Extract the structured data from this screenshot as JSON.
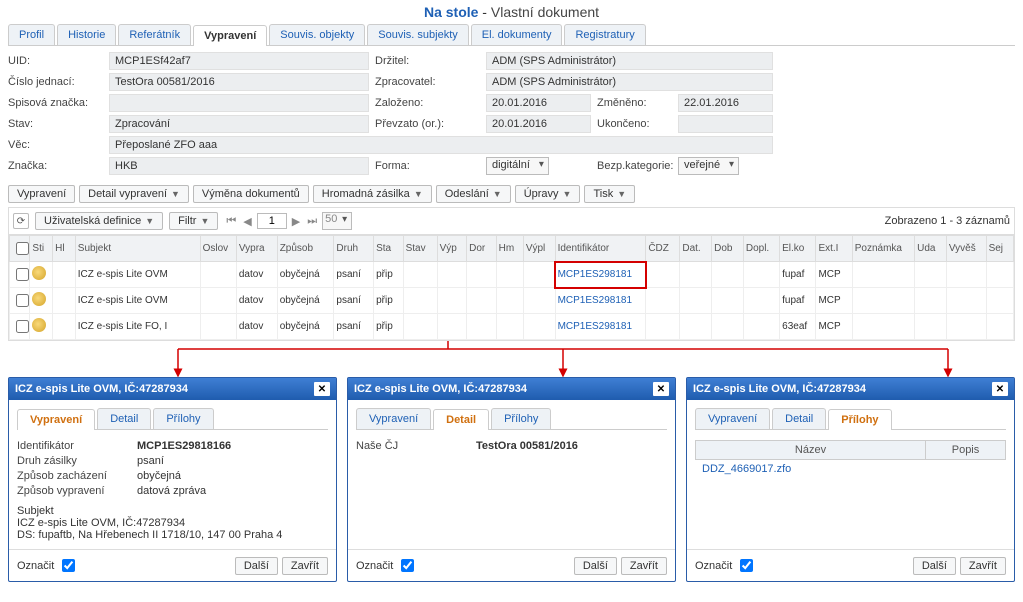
{
  "page": {
    "title1": "Na stole",
    "sep": " - ",
    "title2": "Vlastní dokument"
  },
  "mainTabs": [
    "Profil",
    "Historie",
    "Referátník",
    "Vypravení",
    "Souvis. objekty",
    "Souvis. subjekty",
    "El. dokumenty",
    "Registratury"
  ],
  "mainTabActive": "Vypravení",
  "form": {
    "labels": {
      "uid": "UID:",
      "cj": "Číslo jednací:",
      "sz": "Spisová značka:",
      "stav": "Stav:",
      "vec": "Věc:",
      "znacka": "Značka:",
      "drzitel": "Držitel:",
      "zprac": "Zpracovatel:",
      "zalozeno": "Založeno:",
      "prevzato": "Převzato (or.):",
      "zmeneno": "Změněno:",
      "ukonceno": "Ukončeno:",
      "forma": "Forma:",
      "bezp": "Bezp.kategorie:"
    },
    "values": {
      "uid": "MCP1ESf42af7",
      "cj": "TestOra 00581/2016",
      "sz": "",
      "stav": "Zpracování",
      "vec": "Přeposlané ZFO aaa",
      "znacka": "HKB",
      "drzitel": "ADM (SPS Administrátor)",
      "zprac": "ADM (SPS Administrátor)",
      "zalozeno": "20.01.2016",
      "prevzato": "20.01.2016",
      "zmeneno": "22.01.2016",
      "ukonceno": "",
      "forma": "digitální",
      "bezp": "veřejné"
    }
  },
  "toolbar": {
    "vypraveni": "Vypravení",
    "detail": "Detail vypravení",
    "vymena": "Výměna dokumentů",
    "hromadna": "Hromadná zásilka",
    "odeslani": "Odeslání",
    "upravy": "Úpravy",
    "tisk": "Tisk"
  },
  "gridbar": {
    "uzdef": "Uživatelská definice",
    "filtr": "Filtr",
    "page": "1",
    "pagesize": "50",
    "summary": "Zobrazeno 1 - 3 záznamů"
  },
  "gridCols": [
    "",
    "Sti",
    "Hl",
    "Subjekt",
    "Oslov",
    "Vypra",
    "Způsob",
    "Druh",
    "Sta",
    "Stav",
    "Výp",
    "Dor",
    "Hm",
    "Výpl",
    "Identifikátor",
    "ČDZ",
    "Dat.",
    "Dob",
    "Dopl.",
    "El.ko",
    "Ext.I",
    "Poznámka",
    "Uda",
    "Vyvěš",
    "Sej"
  ],
  "gridRows": [
    {
      "subjekt": "ICZ e-spis Lite OVM",
      "vypra": "datov",
      "zpusob": "obyčejná",
      "druh": "psaní",
      "sta": "přip",
      "ident": "MCP1ES298181",
      "elko": "fupaf",
      "exti": "MCP"
    },
    {
      "subjekt": "ICZ e-spis Lite OVM",
      "vypra": "datov",
      "zpusob": "obyčejná",
      "druh": "psaní",
      "sta": "přip",
      "ident": "MCP1ES298181",
      "elko": "fupaf",
      "exti": "MCP"
    },
    {
      "subjekt": "ICZ e-spis Lite FO, I",
      "vypra": "datov",
      "zpusob": "obyčejná",
      "druh": "psaní",
      "sta": "přip",
      "ident": "MCP1ES298181",
      "elko": "63eaf",
      "exti": "MCP"
    }
  ],
  "panelTitle": "ICZ e-spis Lite OVM, IČ:47287934",
  "innerTabs": {
    "vypraveni": "Vypravení",
    "detail": "Detail",
    "prilohy": "Přílohy"
  },
  "panel1": {
    "kv": {
      "ident_k": "Identifikátor",
      "ident_v": "MCP1ES29818166",
      "druh_k": "Druh zásilky",
      "druh_v": "psaní",
      "zach_k": "Způsob zacházení",
      "zach_v": "obyčejná",
      "vypr_k": "Způsob vypravení",
      "vypr_v": "datová zpráva"
    },
    "subj_h": "Subjekt",
    "subj_l1": "ICZ e-spis Lite OVM, IČ:47287934",
    "subj_l2": "DS: fupaftb, Na Hřebenech II 1718/10, 147 00 Praha 4"
  },
  "panel2": {
    "nase_k": "Naše ČJ",
    "nase_v": "TestOra 00581/2016"
  },
  "panel3": {
    "col_nazev": "Název",
    "col_popis": "Popis",
    "row1": "DDZ_4669017.zfo"
  },
  "foot": {
    "oznacit": "Označit",
    "dalsi": "Další",
    "zavrit": "Zavřít"
  }
}
